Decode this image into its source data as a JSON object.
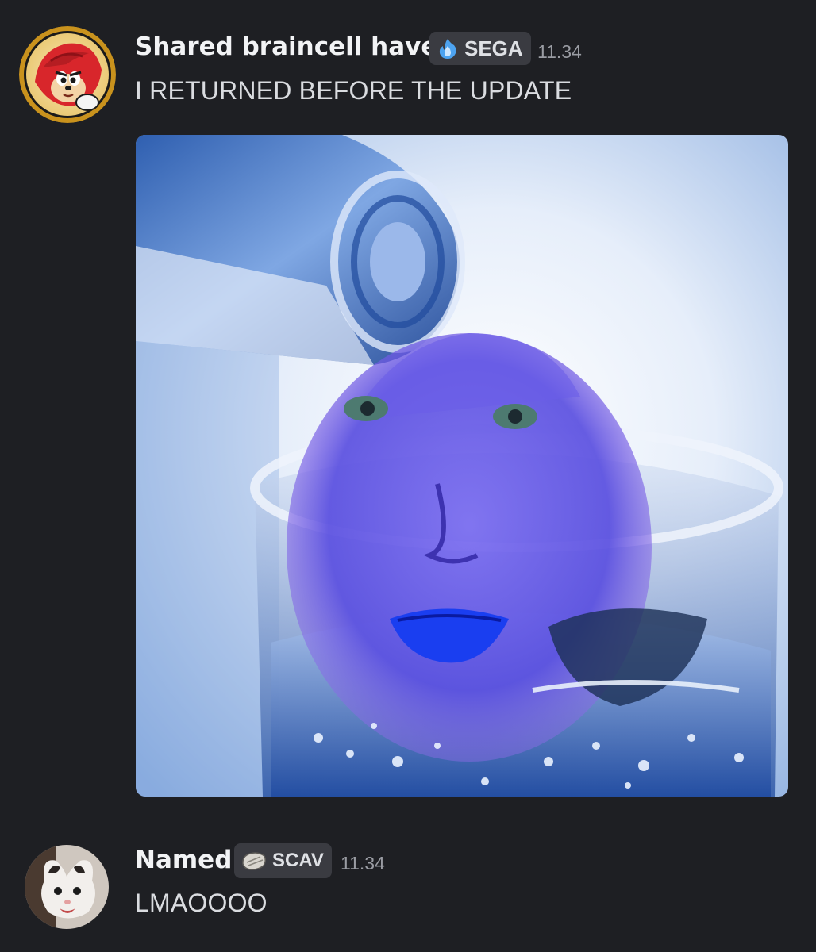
{
  "messages": [
    {
      "author": "Shared braincell haver",
      "tag": "SEGA",
      "tag_icon": "blue-flame-icon",
      "time": "11.34",
      "text": "I RETURNED BEFORE THE UPDATE",
      "avatar": "knuckles-avatar"
    },
    {
      "author": "Named",
      "tag": "SCAV",
      "tag_icon": "stone-icon",
      "time": "11.34",
      "text": "LMAOOOO",
      "avatar": "cat-avatar"
    }
  ],
  "colors": {
    "background": "#1e1f23",
    "tag_background": "#3a3b41",
    "author": "#f2f3f5",
    "timestamp": "#9a9ca3"
  }
}
